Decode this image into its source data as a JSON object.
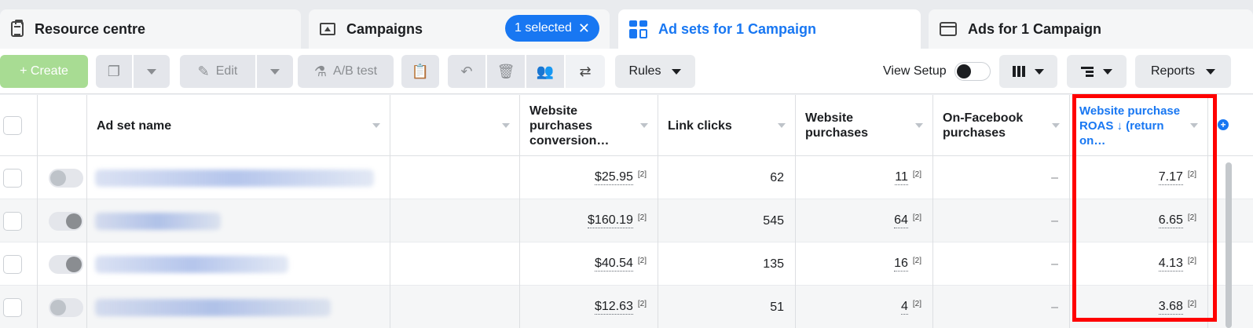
{
  "tabs": [
    {
      "label": "Resource centre",
      "icon": "clipboard-icon"
    },
    {
      "label": "Campaigns",
      "icon": "folder-icon",
      "badge": "1 selected"
    },
    {
      "label": "Ad sets for 1 Campaign",
      "icon": "grid-icon",
      "active": true
    },
    {
      "label": "Ads for 1 Campaign",
      "icon": "window-icon"
    }
  ],
  "toolbar": {
    "create": "+ Create",
    "edit": "Edit",
    "ab_test": "A/B test",
    "rules": "Rules",
    "view_setup": "View Setup",
    "reports": "Reports"
  },
  "table": {
    "columns": [
      "Ad set name",
      "",
      "Website purchases conversion…",
      "Link clicks",
      "Website purchases",
      "On-Facebook purchases",
      "Website purchase ROAS ↓ (return on…"
    ],
    "rows": [
      {
        "toggle": "off",
        "conversion": "$25.95",
        "clicks": "62",
        "purchases": "11",
        "onfb": "–",
        "roas": "7.17"
      },
      {
        "toggle": "on",
        "conversion": "$160.19",
        "clicks": "545",
        "purchases": "64",
        "onfb": "–",
        "roas": "6.65"
      },
      {
        "toggle": "on",
        "conversion": "$40.54",
        "clicks": "135",
        "purchases": "16",
        "onfb": "–",
        "roas": "4.13"
      },
      {
        "toggle": "off",
        "conversion": "$12.63",
        "clicks": "51",
        "purchases": "4",
        "onfb": "–",
        "roas": "3.68"
      }
    ],
    "footnote": "[2]"
  },
  "colors": {
    "accent": "#1877f2",
    "highlight": "#ff0000",
    "create": "#a8dc93"
  }
}
